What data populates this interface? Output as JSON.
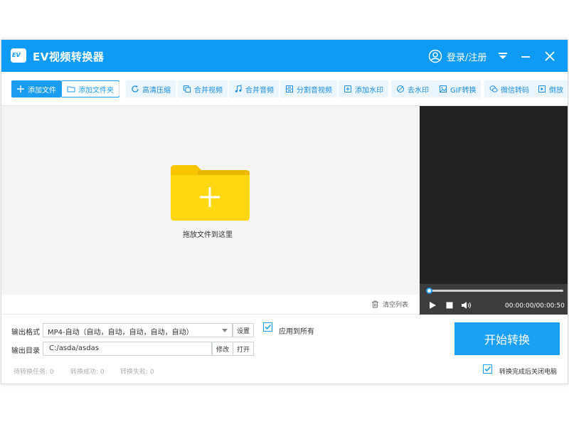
{
  "app": {
    "title": "EV视频转换器",
    "logo_text": "EV",
    "login_label": "登录/注册",
    "accent_color": "#0e9bf5"
  },
  "toolbar": {
    "add_file": "添加文件",
    "add_folder": "添加文件夹",
    "tools": [
      {
        "label": "高清压缩",
        "icon": "refresh-icon"
      },
      {
        "label": "合并视频",
        "icon": "copy-icon"
      },
      {
        "label": "合并音频",
        "icon": "music-note-icon"
      },
      {
        "label": "分割音视频",
        "icon": "split-icon"
      },
      {
        "label": "添加水印",
        "icon": "watermark-icon"
      },
      {
        "label": "去水印",
        "icon": "remove-watermark-icon"
      },
      {
        "label": "GIF转换",
        "icon": "gif-icon"
      },
      {
        "label": "微信转码",
        "icon": "wechat-icon"
      },
      {
        "label": "倒放",
        "icon": "reverse-play-icon"
      }
    ]
  },
  "drop_area": {
    "label": "拖放文件到这里",
    "clear_list": "清空列表"
  },
  "player": {
    "time": "00:00:00/00:00:50",
    "progress": 0
  },
  "output": {
    "format_label": "输出格式",
    "format_value": "MP4-自动（自动，自动，自动，自动，自动）",
    "settings_btn": "设置",
    "apply_all_label": "应用到所有",
    "apply_all_checked": true,
    "dir_label": "输出目录",
    "dir_value": "C:/asda/asdas",
    "modify_btn": "修改",
    "open_btn": "打开"
  },
  "status": {
    "pending": "待转换任务: 0",
    "success": "转换成功: 0",
    "failed": "转换失败: 0"
  },
  "start_button": "开始转换",
  "shutdown_label": "转换完成后关闭电脑",
  "shutdown_checked": true
}
